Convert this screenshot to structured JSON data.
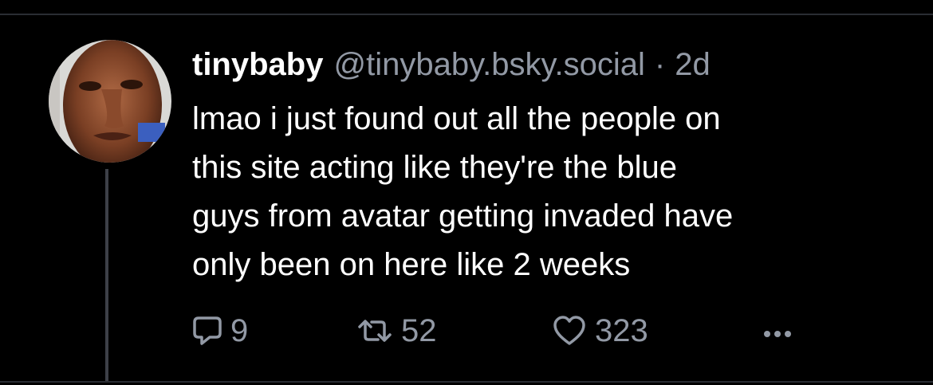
{
  "post": {
    "display_name": "tinybaby",
    "handle": "@tinybaby.bsky.social",
    "separator": "·",
    "time": "2d",
    "text_lines": [
      "lmao i just found out all the people on",
      "this site acting like they're the blue",
      "guys from avatar getting invaded have",
      "only been on here like 2 weeks"
    ]
  },
  "actions": {
    "reply_icon": "speech-bubble-icon",
    "reply_count": "9",
    "repost_icon": "repost-arrows-icon",
    "repost_count": "52",
    "like_icon": "heart-outline-icon",
    "like_count": "323",
    "more_icon": "ellipsis-icon"
  },
  "colors": {
    "background": "#000000",
    "text_primary": "#ffffff",
    "text_secondary": "#9299a5",
    "divider": "#2a2d33",
    "thread_line": "#3d4048"
  }
}
